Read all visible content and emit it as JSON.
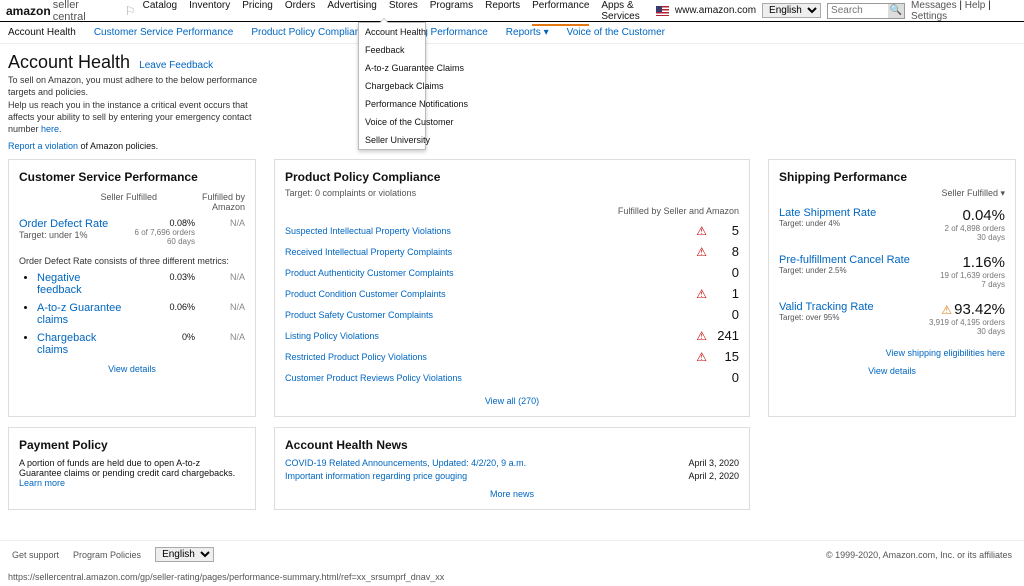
{
  "brand": {
    "amazon": "amazon",
    "sc": "seller central"
  },
  "topnav": [
    "Catalog",
    "Inventory",
    "Pricing",
    "Orders",
    "Advertising",
    "Stores",
    "Programs",
    "Reports",
    "Performance",
    "Apps & Services"
  ],
  "topnav_active": 8,
  "domain": "www.amazon.com",
  "lang": "English",
  "search_placeholder": "Search",
  "topright_links": [
    "Messages",
    "Help",
    "Settings"
  ],
  "subnav": [
    "Account Health",
    "Customer Service Performance",
    "Product Policy Compliance",
    "Shipping Performance",
    "Reports",
    "Voice of the Customer"
  ],
  "dropdown": [
    "Account Health",
    "Feedback",
    "A-to-z Guarantee Claims",
    "Chargeback Claims",
    "Performance Notifications",
    "Voice of the Customer",
    "Seller University"
  ],
  "page": {
    "title": "Account Health",
    "leave_feedback": "Leave Feedback",
    "p1": "To sell on Amazon, you must adhere to the below performance targets and policies.",
    "p2a": "Help us reach you in the instance a critical event occurs that affects your ability to sell by entering your emergency contact number ",
    "p2_here": "here",
    "rv_a": "Report a violation",
    "rv_b": " of Amazon policies."
  },
  "csp": {
    "title": "Customer Service Performance",
    "col1": "Seller Fulfilled",
    "col2": "Fulfilled by Amazon",
    "odr_label": "Order Defect Rate",
    "odr_target": "Target: under 1%",
    "odr_val": "0.08%",
    "odr_sub1": "6 of 7,696 orders",
    "odr_sub2": "60 days",
    "na": "N/A",
    "consists": "Order Defect Rate consists of three different metrics:",
    "m1": "Negative feedback",
    "m1v": "0.03%",
    "m2": "A-to-z Guarantee claims",
    "m2v": "0.06%",
    "m3": "Chargeback claims",
    "m3v": "0%",
    "view": "View details"
  },
  "ppc": {
    "title": "Product Policy Compliance",
    "target": "Target: 0 complaints or violations",
    "head": "Fulfilled by Seller and Amazon",
    "rows": [
      {
        "label": "Suspected Intellectual Property Violations",
        "warn": true,
        "count": "5"
      },
      {
        "label": "Received Intellectual Property Complaints",
        "warn": true,
        "count": "8"
      },
      {
        "label": "Product Authenticity Customer Complaints",
        "warn": false,
        "count": "0"
      },
      {
        "label": "Product Condition Customer Complaints",
        "warn": true,
        "count": "1"
      },
      {
        "label": "Product Safety Customer Complaints",
        "warn": false,
        "count": "0"
      },
      {
        "label": "Listing Policy Violations",
        "warn": true,
        "count": "241"
      },
      {
        "label": "Restricted Product Policy Violations",
        "warn": true,
        "count": "15"
      },
      {
        "label": "Customer Product Reviews Policy Violations",
        "warn": false,
        "count": "0"
      }
    ],
    "view": "View all (270)"
  },
  "ship": {
    "title": "Shipping Performance",
    "head": "Seller Fulfilled",
    "blocks": [
      {
        "label": "Late Shipment Rate",
        "target": "Target: under 4%",
        "val": "0.04%",
        "d1": "2 of 4,898 orders",
        "d2": "30 days",
        "warn": ""
      },
      {
        "label": "Pre-fulfillment Cancel Rate",
        "target": "Target: under 2.5%",
        "val": "1.16%",
        "d1": "19 of 1,639 orders",
        "d2": "7 days",
        "warn": ""
      },
      {
        "label": "Valid Tracking Rate",
        "target": "Target: over 95%",
        "val": "93.42%",
        "d1": "3,919 of 4,195 orders",
        "d2": "30 days",
        "warn": "⚠"
      }
    ],
    "elig": "View shipping eligibilities here",
    "view": "View details"
  },
  "payment": {
    "title": "Payment Policy",
    "text": "A portion of funds are held due to open A-to-z Guarantee claims or pending credit card chargebacks. ",
    "learn": "Learn more"
  },
  "news": {
    "title": "Account Health News",
    "rows": [
      {
        "t": "COVID-19 Related Announcements, Updated: 4/2/20, 9 a.m.",
        "d": "April 3, 2020"
      },
      {
        "t": "Important information regarding price gouging",
        "d": "April 2, 2020"
      }
    ],
    "more": "More news"
  },
  "footer": {
    "support": "Get support",
    "policies": "Program Policies",
    "lang": "English",
    "copy": "© 1999-2020, Amazon.com, Inc. or its affiliates"
  },
  "statusbar": "https://sellercentral.amazon.com/gp/seller-rating/pages/performance-summary.html/ref=xx_srsumprf_dnav_xx"
}
